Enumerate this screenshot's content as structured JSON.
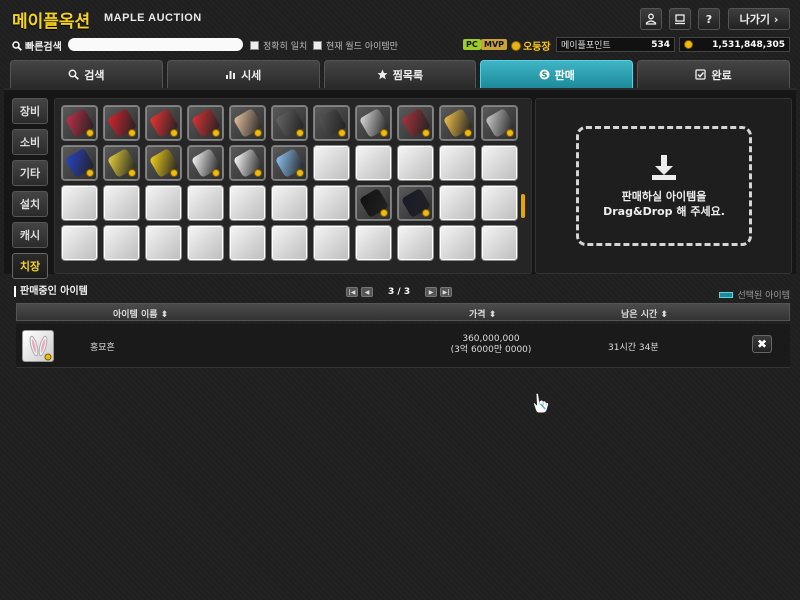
{
  "header": {
    "logo_ko": "메이플옥션",
    "logo_en": "MAPLE AUCTION",
    "exit_label": "나가기 ›",
    "help_label": "?"
  },
  "search": {
    "label": "빠른검색",
    "placeholder": "",
    "exact_match": "정확히 일치",
    "current_world": "현재 월드 아이템만"
  },
  "status": {
    "pc_badge": "PC",
    "mvp_badge": "MVP",
    "server": "오둥장",
    "maple_point_label": "메이플포인트",
    "maple_point_value": "534",
    "meso_value": "1,531,848,305"
  },
  "tabs": [
    {
      "label": "검색",
      "icon": "search-icon"
    },
    {
      "label": "시세",
      "icon": "bar-chart-icon"
    },
    {
      "label": "찜목록",
      "icon": "star-icon"
    },
    {
      "label": "판매",
      "icon": "coin-s-icon"
    },
    {
      "label": "완료",
      "icon": "check-box-icon"
    }
  ],
  "active_tab": "판매",
  "categories": [
    "장비",
    "소비",
    "기타",
    "설치",
    "캐시",
    "치장"
  ],
  "active_category": "치장",
  "drop_zone": {
    "line1": "판매하실 아이템을",
    "line2": "Drag&Drop 해 주세요."
  },
  "selling": {
    "title": "판매중인 아이템",
    "page": "3 / 3",
    "legend": "선택된 아이템",
    "col_name": "아이템 이름",
    "col_price": "가격",
    "col_time": "남은 시간",
    "items": [
      {
        "name": "홍묘흔",
        "price": "360,000,000",
        "price_korean": "(3억 6000만 0000)",
        "time_left": "31시간 34분",
        "cancel": "✖"
      }
    ]
  },
  "colors": {
    "accent_teal": "#1d8a9a",
    "logo_yellow": "#f5d21c",
    "coin_gold": "#f0b90b"
  }
}
